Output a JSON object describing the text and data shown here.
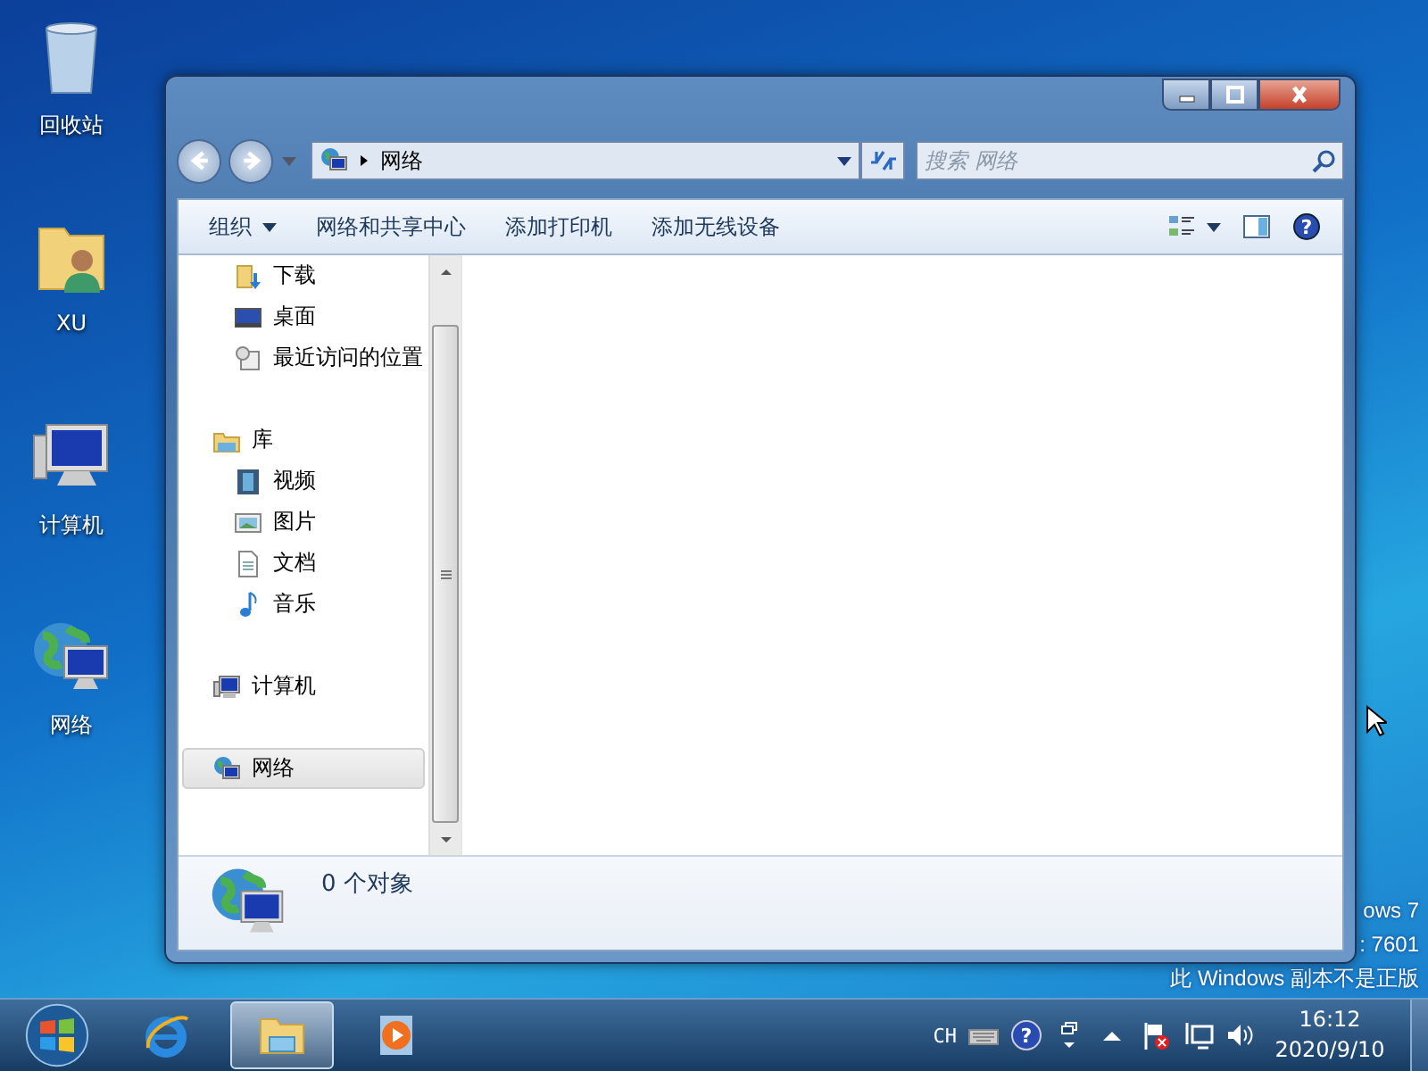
{
  "desktop": {
    "icons": [
      {
        "label": "回收站",
        "kind": "recycle"
      },
      {
        "label": "XU",
        "kind": "user"
      },
      {
        "label": "计算机",
        "kind": "computer"
      },
      {
        "label": "网络",
        "kind": "network"
      }
    ],
    "notice": [
      "ows 7",
      ": 7601",
      "此 Windows 副本不是正版"
    ]
  },
  "window": {
    "address": {
      "path": "网络"
    },
    "search": {
      "placeholder": "搜索 网络"
    },
    "toolbar": [
      {
        "label": "组织",
        "dropdown": true
      },
      {
        "label": "网络和共享中心",
        "dropdown": false
      },
      {
        "label": "添加打印机",
        "dropdown": false
      },
      {
        "label": "添加无线设备",
        "dropdown": false
      }
    ],
    "nav_pane": [
      {
        "children": [
          {
            "label": "下载",
            "kind": "downloads",
            "selected": false
          },
          {
            "label": "桌面",
            "kind": "desktop",
            "selected": false
          },
          {
            "label": "最近访问的位置",
            "kind": "recent",
            "selected": false
          }
        ]
      },
      {
        "label": "库",
        "kind": "library",
        "selected": false,
        "children": [
          {
            "label": "视频",
            "kind": "video",
            "selected": false
          },
          {
            "label": "图片",
            "kind": "pictures",
            "selected": false
          },
          {
            "label": "文档",
            "kind": "documents",
            "selected": false
          },
          {
            "label": "音乐",
            "kind": "music",
            "selected": false
          }
        ]
      },
      {
        "label": "计算机",
        "kind": "computer",
        "selected": false
      },
      {
        "label": "网络",
        "kind": "network",
        "selected": true
      }
    ],
    "help": "?",
    "details": {
      "text": "0 个对象"
    }
  },
  "taskbar": {
    "apps": [
      {
        "kind": "ie",
        "selected": false
      },
      {
        "kind": "explorer",
        "selected": true
      },
      {
        "kind": "media",
        "selected": false
      }
    ],
    "tray": {
      "language": "CH",
      "help": "?",
      "time": "16:12",
      "date": "2020/9/10"
    }
  }
}
